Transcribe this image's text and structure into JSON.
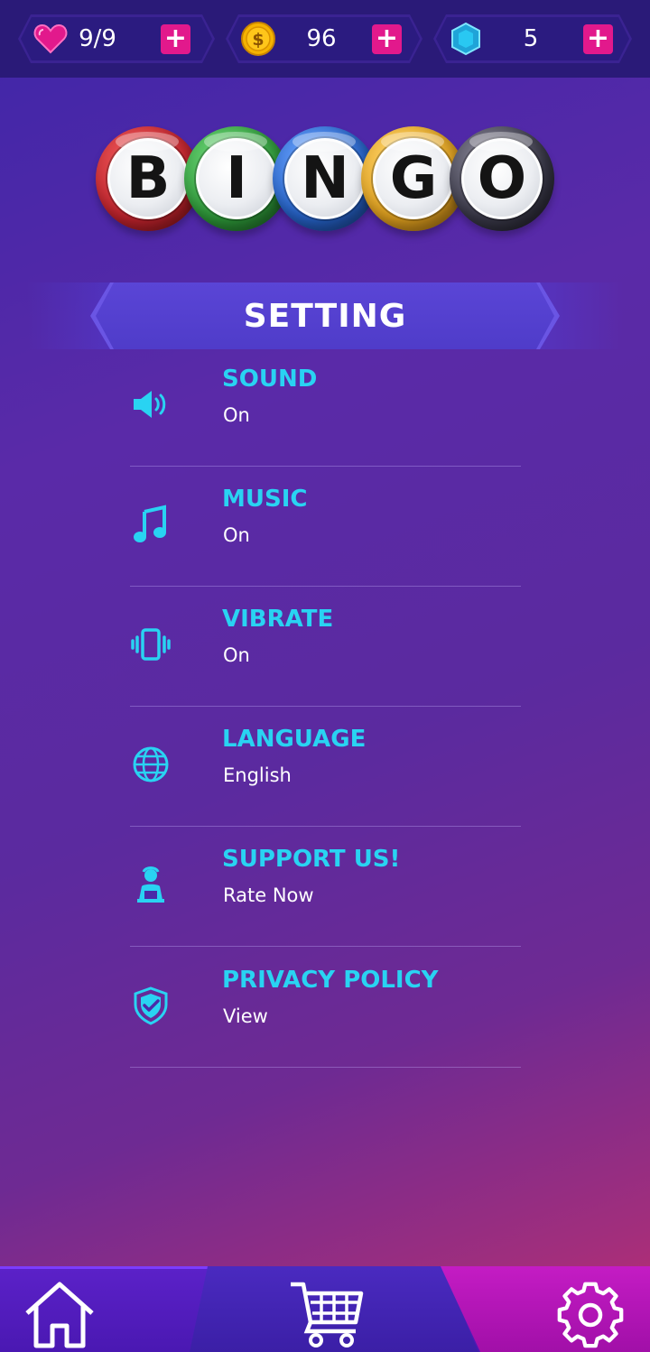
{
  "resources": [
    {
      "name": "lives",
      "icon": "heart-icon",
      "value": "9/9",
      "color": "#e2198c"
    },
    {
      "name": "coins",
      "icon": "coin-icon",
      "value": "96",
      "color": "#f5b301"
    },
    {
      "name": "gems",
      "icon": "gem-icon",
      "value": "5",
      "color": "#29c8f2"
    }
  ],
  "plus_label": "+",
  "logo": {
    "letters": [
      "B",
      "I",
      "N",
      "G",
      "O"
    ],
    "ball_colors": [
      "#c4242e",
      "#2f9b3a",
      "#2663c9",
      "#e2a21f",
      "#3b3a4a"
    ]
  },
  "header": {
    "title": "SETTING"
  },
  "settings": [
    {
      "icon": "speaker-icon",
      "label": "SOUND",
      "value": "On"
    },
    {
      "icon": "music-note-icon",
      "label": "MUSIC",
      "value": "On"
    },
    {
      "icon": "vibrate-icon",
      "label": "VIBRATE",
      "value": "On"
    },
    {
      "icon": "globe-icon",
      "label": "LANGUAGE",
      "value": "English"
    },
    {
      "icon": "support-agent-icon",
      "label": "SUPPORT US!",
      "value": "Rate Now"
    },
    {
      "icon": "shield-check-icon",
      "label": "PRIVACY POLICY",
      "value": "View"
    }
  ],
  "nav": [
    {
      "icon": "home-icon",
      "active": false
    },
    {
      "icon": "cart-icon",
      "active": false
    },
    {
      "icon": "gear-icon",
      "active": true
    }
  ],
  "colors": {
    "accent": "#29d3f2",
    "plus": "#e2198c",
    "active_tab": "#c41cc4"
  }
}
